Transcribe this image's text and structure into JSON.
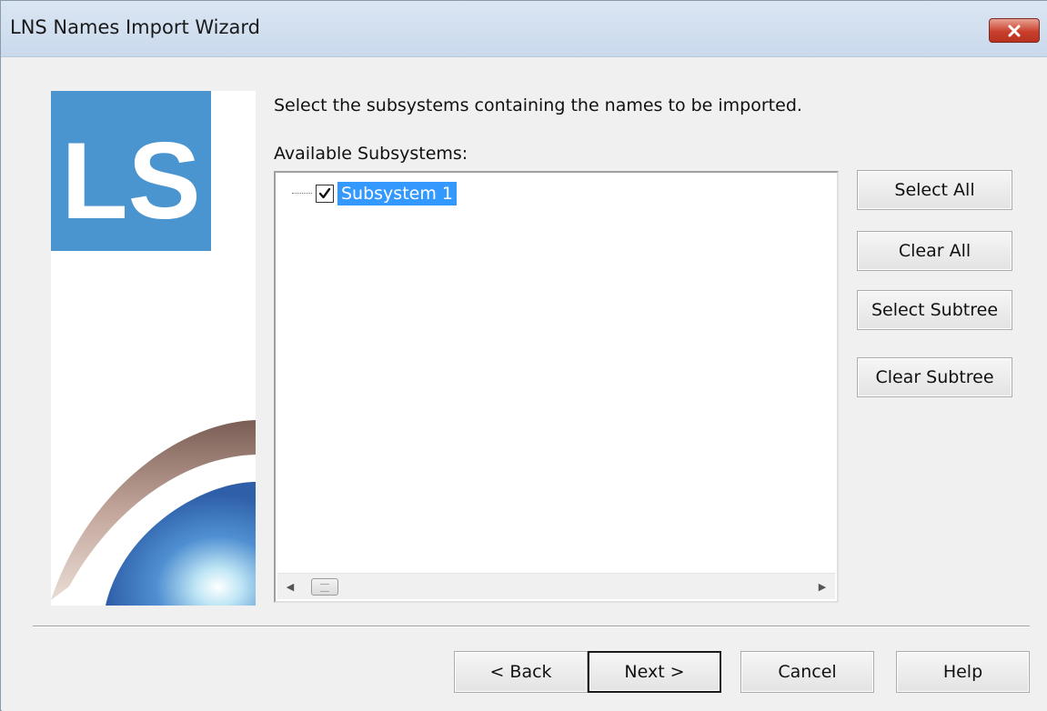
{
  "window": {
    "title": "LNS Names Import Wizard"
  },
  "logo": {
    "text": "LS",
    "color": "#4a94cf"
  },
  "instruction": "Select the subsystems containing the names to be imported.",
  "tree": {
    "label": "Available Subsystems:",
    "items": [
      {
        "label": "Subsystem 1",
        "checked": true,
        "selected": true
      }
    ]
  },
  "side_buttons": {
    "select_all": "Select All",
    "clear_all": "Clear All",
    "select_subtree": "Select Subtree",
    "clear_subtree": "Clear Subtree"
  },
  "nav_buttons": {
    "back": "< Back",
    "next": "Next >",
    "cancel": "Cancel",
    "help": "Help"
  },
  "icons": {
    "close": "close-icon",
    "checkbox": "checkmark-icon",
    "scroll_left": "arrow-left-icon",
    "scroll_right": "arrow-right-icon"
  },
  "colors": {
    "selection": "#3399ff",
    "close_button": "#c9402d",
    "logo_blue": "#4a94cf"
  }
}
